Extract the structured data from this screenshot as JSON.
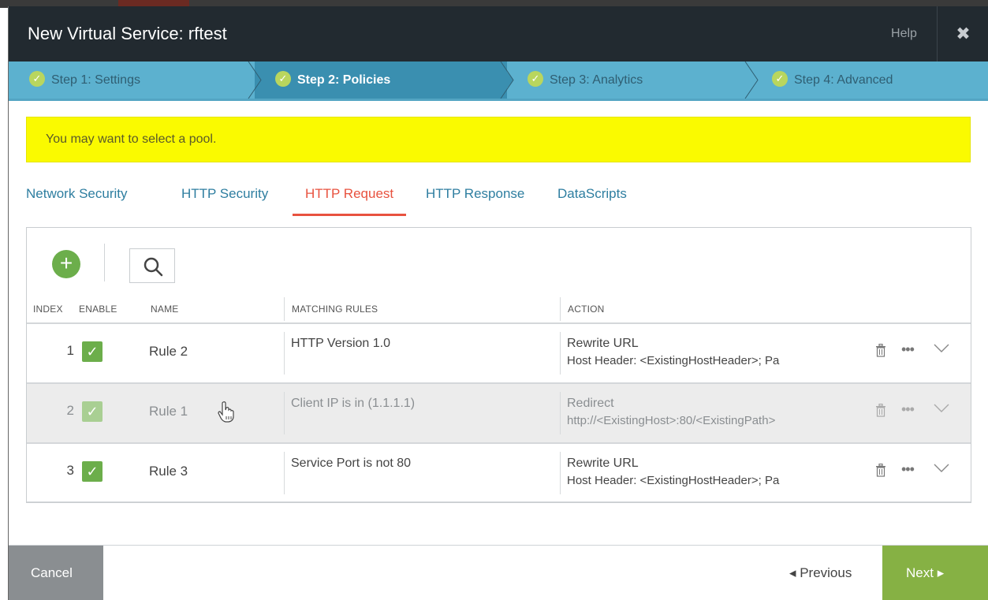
{
  "window": {
    "title": "New Virtual Service: rftest",
    "help_label": "Help",
    "close_glyph": "✖"
  },
  "steps": [
    {
      "label": "Step 1: Settings",
      "state": "done"
    },
    {
      "label": "Step 2: Policies",
      "state": "active"
    },
    {
      "label": "Step 3: Analytics",
      "state": "done"
    },
    {
      "label": "Step 4: Advanced",
      "state": "done"
    }
  ],
  "alert": {
    "message": "You may want to select a pool.",
    "color": "#fafa00"
  },
  "tabs": [
    {
      "label": "Network Security",
      "active": false
    },
    {
      "label": "HTTP Security",
      "active": false
    },
    {
      "label": "HTTP Request",
      "active": true
    },
    {
      "label": "HTTP Response",
      "active": false
    },
    {
      "label": "DataScripts",
      "active": false
    }
  ],
  "toolbar": {
    "add_icon": "plus-circle-icon",
    "search_icon": "search-icon"
  },
  "table": {
    "columns": [
      "INDEX",
      "ENABLE",
      "NAME",
      "MATCHING RULES",
      "ACTION"
    ],
    "rows": [
      {
        "index": "1",
        "enabled": true,
        "name": "Rule 2",
        "match": "HTTP Version 1.0",
        "action_title": "Rewrite URL",
        "action_detail": "Host Header: <ExistingHostHeader>; Pa"
      },
      {
        "index": "2",
        "enabled": true,
        "name": "Rule 1",
        "match": "Client IP is in (1.1.1.1)",
        "action_title": "Redirect",
        "action_detail": "http://<ExistingHost>:80/<ExistingPath>"
      },
      {
        "index": "3",
        "enabled": true,
        "name": "Rule 3",
        "match": "Service Port is not 80",
        "action_title": "Rewrite URL",
        "action_detail": "Host Header: <ExistingHostHeader>; Pa"
      }
    ]
  },
  "footer": {
    "cancel_label": "Cancel",
    "previous_label": "Previous",
    "next_label": "Next"
  },
  "colors": {
    "accent_green": "#6cae4b",
    "tab_active": "#e8523f",
    "steps_bg": "#5cb1cf"
  }
}
